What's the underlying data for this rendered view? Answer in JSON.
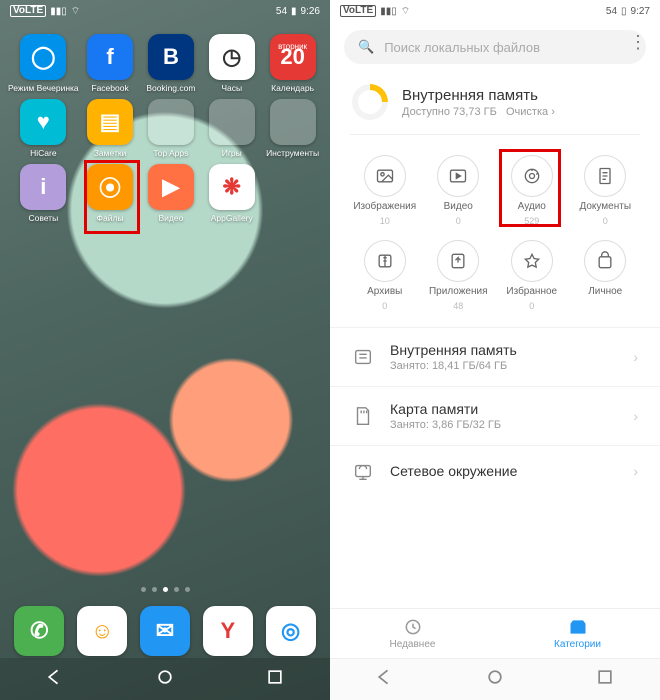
{
  "left": {
    "status": {
      "volte": "VoLTE",
      "battery": "54",
      "time": "9:26"
    },
    "apps": [
      {
        "label": "Режим Вечеринка",
        "bg": "#0091ea",
        "glyph": "◯"
      },
      {
        "label": "Facebook",
        "bg": "#1877f2",
        "glyph": "f"
      },
      {
        "label": "Booking.com",
        "bg": "#003580",
        "glyph": "B"
      },
      {
        "label": "Часы",
        "bg": "#ffffff",
        "glyph": "◷",
        "fg": "#333"
      },
      {
        "label": "Календарь",
        "bg": "#e53935",
        "glyph": "20",
        "badge": "вторник"
      },
      {
        "label": "HiCare",
        "bg": "#00bcd4",
        "glyph": "♥"
      },
      {
        "label": "Заметки",
        "bg": "#ffb300",
        "glyph": "▤",
        "fg": "#fff"
      },
      {
        "label": "Top Apps",
        "type": "folder"
      },
      {
        "label": "Игры",
        "type": "folder"
      },
      {
        "label": "Инструменты",
        "type": "folder"
      },
      {
        "label": "Советы",
        "bg": "#b39ddb",
        "glyph": "i"
      },
      {
        "label": "Файлы",
        "bg": "#ff9800",
        "glyph": "⦿",
        "highlight": true
      },
      {
        "label": "Видео",
        "bg": "#ff7043",
        "glyph": "▶"
      },
      {
        "label": "AppGallery",
        "bg": "#ffffff",
        "glyph": "❋",
        "fg": "#e53935"
      }
    ],
    "dock": [
      {
        "bg": "#4caf50",
        "glyph": "✆"
      },
      {
        "bg": "#ffffff",
        "glyph": "☺",
        "fg": "#ff9800"
      },
      {
        "bg": "#2196f3",
        "glyph": "✉"
      },
      {
        "bg": "#ffffff",
        "glyph": "Y",
        "fg": "#e53935"
      },
      {
        "bg": "#ffffff",
        "glyph": "◎",
        "fg": "#2196f3"
      }
    ]
  },
  "right": {
    "status": {
      "volte": "VoLTE",
      "battery": "54",
      "time": "9:27"
    },
    "search_placeholder": "Поиск локальных файлов",
    "storage": {
      "title": "Внутренняя память",
      "subtitle": "Доступно 73,73 ГБ",
      "cleanup": "Очистка ›"
    },
    "categories": [
      {
        "label": "Изображения",
        "count": "10",
        "icon": "image"
      },
      {
        "label": "Видео",
        "count": "0",
        "icon": "video"
      },
      {
        "label": "Аудио",
        "count": "529",
        "icon": "audio",
        "highlight": true
      },
      {
        "label": "Документы",
        "count": "0",
        "icon": "doc"
      },
      {
        "label": "Архивы",
        "count": "0",
        "icon": "archive"
      },
      {
        "label": "Приложения",
        "count": "48",
        "icon": "apk"
      },
      {
        "label": "Избранное",
        "count": "0",
        "icon": "fav"
      },
      {
        "label": "Личное",
        "count": "",
        "icon": "safe"
      }
    ],
    "locations": [
      {
        "title": "Внутренняя память",
        "subtitle": "Занято: 18,41 ГБ/64 ГБ",
        "icon": "internal"
      },
      {
        "title": "Карта памяти",
        "subtitle": "Занято: 3,86 ГБ/32 ГБ",
        "icon": "sd"
      },
      {
        "title": "Сетевое окружение",
        "subtitle": "",
        "icon": "net"
      }
    ],
    "tabs": {
      "recent": "Недавнее",
      "categories": "Категории"
    }
  }
}
